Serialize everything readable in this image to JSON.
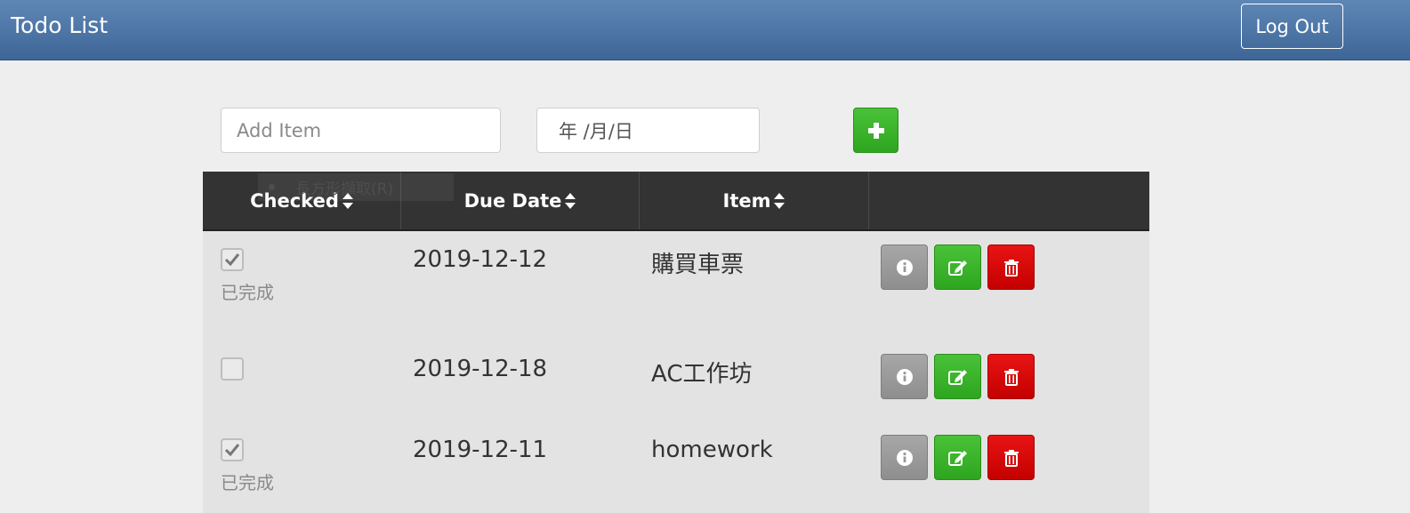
{
  "navbar": {
    "title": "Todo List",
    "logout_label": "Log Out"
  },
  "form": {
    "add_placeholder": "Add Item",
    "date_placeholder": "年 /月/日",
    "add_icon": "plus-icon"
  },
  "overlay": {
    "ghost_menu_label": "長方形擷取(R)"
  },
  "table": {
    "headers": [
      {
        "label": "Checked",
        "sortable": true
      },
      {
        "label": "Due Date",
        "sortable": true
      },
      {
        "label": "Item",
        "sortable": true
      },
      {
        "label": "",
        "sortable": false
      }
    ],
    "rows": [
      {
        "checked": true,
        "status": "已完成",
        "due_date": "2019-12-12",
        "item": "購買車票"
      },
      {
        "checked": false,
        "status": "",
        "due_date": "2019-12-18",
        "item": "AC工作坊"
      },
      {
        "checked": true,
        "status": "已完成",
        "due_date": "2019-12-11",
        "item": "homework"
      }
    ],
    "action_icons": [
      "info-icon",
      "edit-icon",
      "trash-icon"
    ]
  },
  "colors": {
    "navbar": "#4a72a3",
    "header": "#333333",
    "success": "#3cb42c",
    "danger": "#d40000",
    "info": "#9a9a9a"
  }
}
